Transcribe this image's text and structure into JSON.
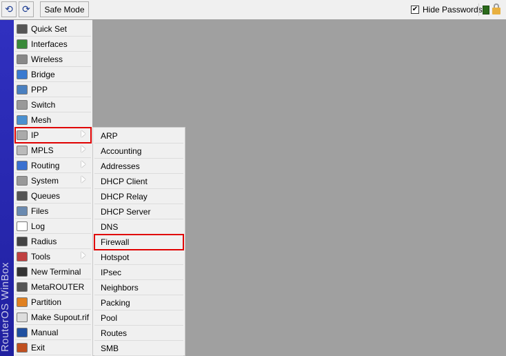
{
  "toolbar": {
    "undo_icon": "undo-icon",
    "redo_icon": "redo-icon",
    "safe_mode": "Safe Mode",
    "hide_passwords": "Hide Passwords",
    "hide_passwords_checked": true
  },
  "sidebar_title": "RouterOS WinBox",
  "menu": [
    {
      "label": "Quick Set",
      "icon": "wand-icon",
      "color": "#555"
    },
    {
      "label": "Interfaces",
      "icon": "network-card-icon",
      "color": "#3a8a3a"
    },
    {
      "label": "Wireless",
      "icon": "antenna-icon",
      "color": "#888"
    },
    {
      "label": "Bridge",
      "icon": "bridge-icon",
      "color": "#3a7ad0"
    },
    {
      "label": "PPP",
      "icon": "ppp-icon",
      "color": "#4a80c0"
    },
    {
      "label": "Switch",
      "icon": "switch-icon",
      "color": "#999"
    },
    {
      "label": "Mesh",
      "icon": "mesh-icon",
      "color": "#4a90d0"
    },
    {
      "label": "IP",
      "icon": "ip-icon",
      "color": "#aaa",
      "submenu": true,
      "selected": true
    },
    {
      "label": "MPLS",
      "icon": "mpls-icon",
      "color": "#bbb",
      "submenu": true
    },
    {
      "label": "Routing",
      "icon": "routing-icon",
      "color": "#3a70d0",
      "submenu": true
    },
    {
      "label": "System",
      "icon": "gear-icon",
      "color": "#999",
      "submenu": true
    },
    {
      "label": "Queues",
      "icon": "queues-icon",
      "color": "#555"
    },
    {
      "label": "Files",
      "icon": "folder-icon",
      "color": "#6a8ab0"
    },
    {
      "label": "Log",
      "icon": "log-icon",
      "color": "#fff"
    },
    {
      "label": "Radius",
      "icon": "radius-icon",
      "color": "#444"
    },
    {
      "label": "Tools",
      "icon": "tools-icon",
      "color": "#c04040",
      "submenu": true
    },
    {
      "label": "New Terminal",
      "icon": "terminal-icon",
      "color": "#333"
    },
    {
      "label": "MetaROUTER",
      "icon": "metarouter-icon",
      "color": "#555"
    },
    {
      "label": "Partition",
      "icon": "partition-icon",
      "color": "#e08020"
    },
    {
      "label": "Make Supout.rif",
      "icon": "document-icon",
      "color": "#ddd"
    },
    {
      "label": "Manual",
      "icon": "help-icon",
      "color": "#2050a0"
    },
    {
      "label": "Exit",
      "icon": "exit-icon",
      "color": "#c05020"
    }
  ],
  "submenu": [
    "ARP",
    "Accounting",
    "Addresses",
    "DHCP Client",
    "DHCP Relay",
    "DHCP Server",
    "DNS",
    "Firewall",
    "Hotspot",
    "IPsec",
    "Neighbors",
    "Packing",
    "Pool",
    "Routes",
    "SMB"
  ],
  "submenu_selected": "Firewall",
  "colors": {
    "highlight": "#e00000",
    "strip": "#2a2ab0",
    "background": "#a0a0a0"
  }
}
